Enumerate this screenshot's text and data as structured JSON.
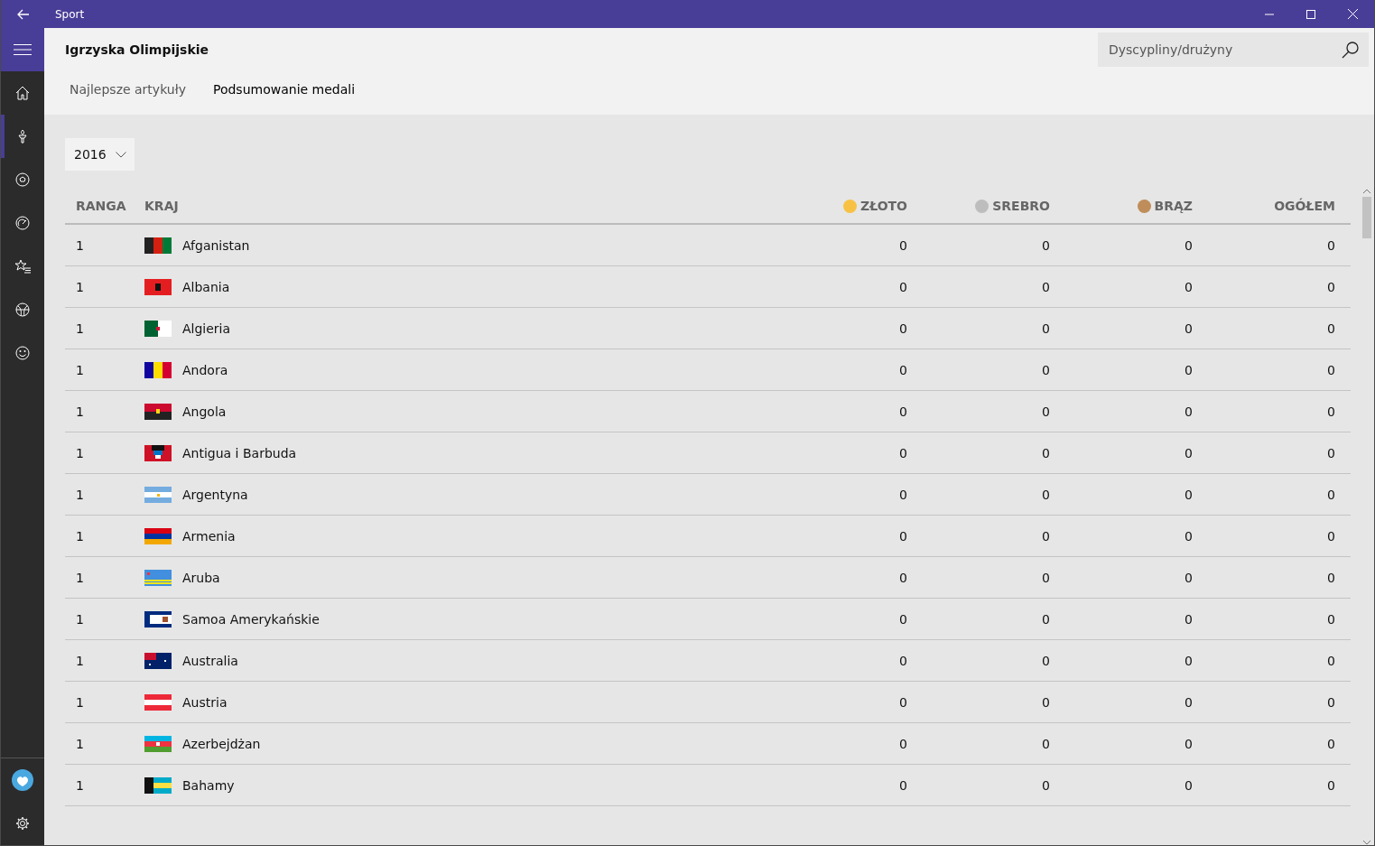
{
  "window": {
    "title": "Sport"
  },
  "sidebar": {
    "items": [
      {
        "selected": false
      },
      {
        "selected": true
      },
      {
        "selected": false
      },
      {
        "selected": false
      },
      {
        "selected": false
      },
      {
        "selected": false
      },
      {
        "selected": false
      }
    ]
  },
  "header": {
    "title": "Igrzyska Olimpijskie",
    "search": {
      "placeholder": "Dyscypliny/drużyny"
    }
  },
  "tabs": [
    {
      "label": "Najlepsze artykuły",
      "selected": false
    },
    {
      "label": "Podsumowanie medali",
      "selected": true
    }
  ],
  "year_dropdown": {
    "value": "2016"
  },
  "table": {
    "columns": [
      {
        "label": "RANGA"
      },
      {
        "label": "KRAJ"
      },
      {
        "label": "ZŁOTO",
        "color": "#f7c244"
      },
      {
        "label": "SREBRO",
        "color": "#bdbdbd"
      },
      {
        "label": "BRĄZ",
        "color": "#bf8d5a"
      },
      {
        "label": "OGÓŁEM"
      }
    ],
    "rows": [
      {
        "rank": "1",
        "country": "Afganistan",
        "gold": "0",
        "silver": "0",
        "bronze": "0",
        "total": "0"
      },
      {
        "rank": "1",
        "country": "Albania",
        "gold": "0",
        "silver": "0",
        "bronze": "0",
        "total": "0"
      },
      {
        "rank": "1",
        "country": "Algieria",
        "gold": "0",
        "silver": "0",
        "bronze": "0",
        "total": "0"
      },
      {
        "rank": "1",
        "country": "Andora",
        "gold": "0",
        "silver": "0",
        "bronze": "0",
        "total": "0"
      },
      {
        "rank": "1",
        "country": "Angola",
        "gold": "0",
        "silver": "0",
        "bronze": "0",
        "total": "0"
      },
      {
        "rank": "1",
        "country": "Antigua i Barbuda",
        "gold": "0",
        "silver": "0",
        "bronze": "0",
        "total": "0"
      },
      {
        "rank": "1",
        "country": "Argentyna",
        "gold": "0",
        "silver": "0",
        "bronze": "0",
        "total": "0"
      },
      {
        "rank": "1",
        "country": "Armenia",
        "gold": "0",
        "silver": "0",
        "bronze": "0",
        "total": "0"
      },
      {
        "rank": "1",
        "country": "Aruba",
        "gold": "0",
        "silver": "0",
        "bronze": "0",
        "total": "0"
      },
      {
        "rank": "1",
        "country": "Samoa Amerykańskie",
        "gold": "0",
        "silver": "0",
        "bronze": "0",
        "total": "0"
      },
      {
        "rank": "1",
        "country": "Australia",
        "gold": "0",
        "silver": "0",
        "bronze": "0",
        "total": "0"
      },
      {
        "rank": "1",
        "country": "Austria",
        "gold": "0",
        "silver": "0",
        "bronze": "0",
        "total": "0"
      },
      {
        "rank": "1",
        "country": "Azerbejdżan",
        "gold": "0",
        "silver": "0",
        "bronze": "0",
        "total": "0"
      },
      {
        "rank": "1",
        "country": "Bahamy",
        "gold": "0",
        "silver": "0",
        "bronze": "0",
        "total": "0"
      }
    ]
  }
}
